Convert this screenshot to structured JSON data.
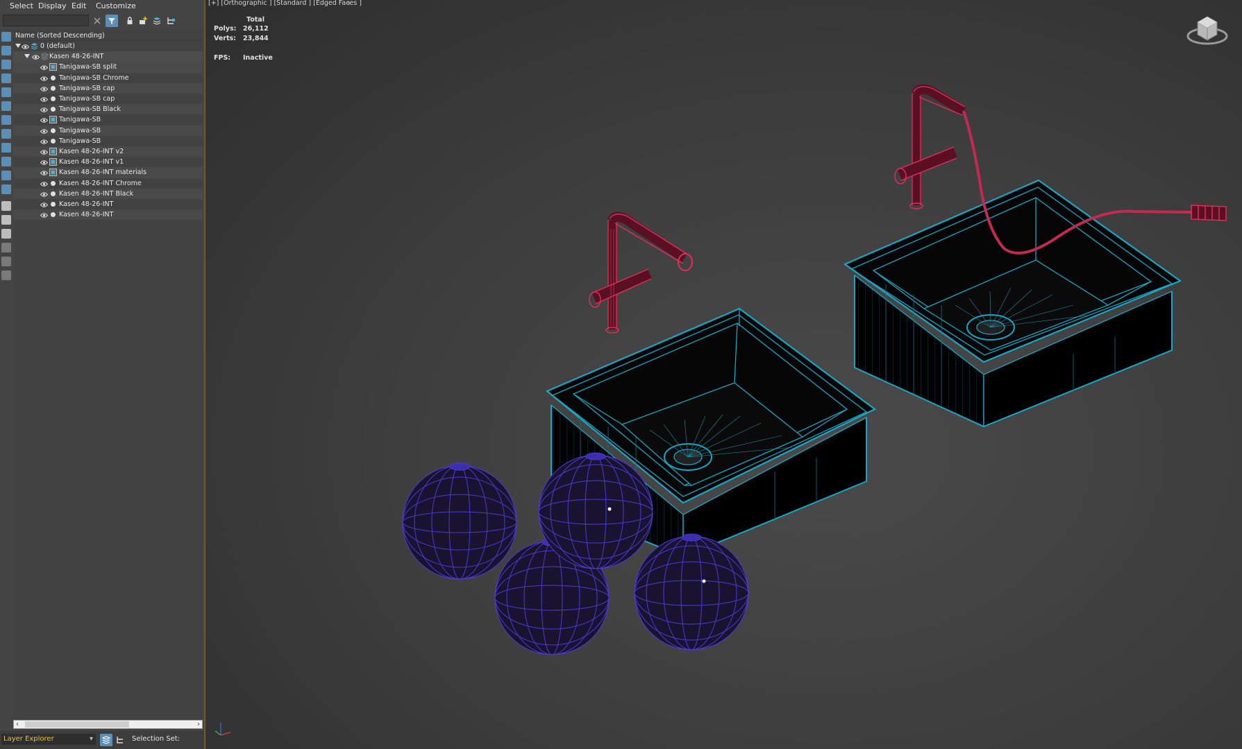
{
  "menu": [
    "Select",
    "Display",
    "Edit",
    "Customize"
  ],
  "tree": {
    "column_header": "Name (Sorted Descending)",
    "root": "0 (default)",
    "group": "Kasen 48-26-INT",
    "items": [
      {
        "label": "Tanigawa-SB split",
        "kind": "container"
      },
      {
        "label": "Tanigawa-SB Chrome",
        "kind": "object"
      },
      {
        "label": "Tanigawa-SB cap",
        "kind": "object"
      },
      {
        "label": "Tanigawa-SB cap",
        "kind": "object"
      },
      {
        "label": "Tanigawa-SB Black",
        "kind": "object"
      },
      {
        "label": "Tanigawa-SB",
        "kind": "container"
      },
      {
        "label": "Tanigawa-SB",
        "kind": "object"
      },
      {
        "label": "Tanigawa-SB",
        "kind": "object"
      },
      {
        "label": "Kasen 48-26-INT v2",
        "kind": "container"
      },
      {
        "label": "Kasen 48-26-INT v1",
        "kind": "container"
      },
      {
        "label": "Kasen 48-26-INT materials",
        "kind": "container"
      },
      {
        "label": "Kasen 48-26-INT Chrome",
        "kind": "object"
      },
      {
        "label": "Kasen 48-26-INT Black",
        "kind": "object"
      },
      {
        "label": "Kasen 48-26-INT",
        "kind": "object"
      },
      {
        "label": "Kasen 48-26-INT",
        "kind": "object"
      }
    ]
  },
  "statusbar": {
    "explorer": "Layer Explorer",
    "selection_set_label": "Selection Set:"
  },
  "viewport": {
    "label": "[+] [Orthographic ] [Standard ] [Edged Faces ]",
    "stats": {
      "total_label": "Total",
      "polys_label": "Polys:",
      "polys": "26,112",
      "verts_label": "Verts:",
      "verts": "23,844",
      "fps_label": "FPS:",
      "fps": "Inactive"
    }
  },
  "colors": {
    "sink_wire": "#1aa6c4",
    "faucet_wire": "#e0305a",
    "sphere_wire": "#4a3ad8",
    "accent": "#e8c430"
  },
  "icons": [
    "close-icon",
    "filter-icon",
    "lock-icon",
    "add-layer-icon",
    "layers-icon",
    "hierarchy-icon",
    "eye-icon",
    "viewcube-icon",
    "axis-tripod-icon"
  ]
}
